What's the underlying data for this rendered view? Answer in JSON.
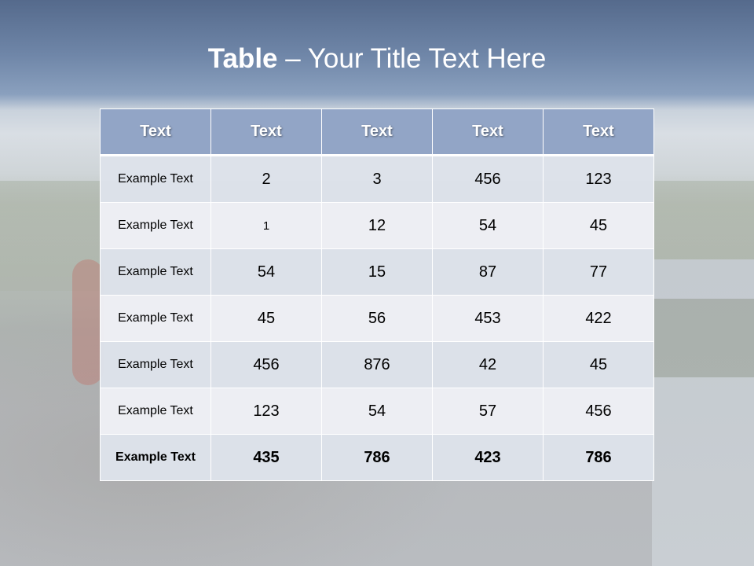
{
  "slide": {
    "title_bold": "Table",
    "title_rest": " – Your Title Text Here"
  },
  "table": {
    "headers": [
      "Text",
      "Text",
      "Text",
      "Text",
      "Text"
    ],
    "rows": [
      {
        "label": "Example Text",
        "values": [
          "2",
          "3",
          "456",
          "123"
        ]
      },
      {
        "label": "Example Text",
        "values": [
          "1",
          "12",
          "54",
          "45"
        ]
      },
      {
        "label": "Example Text",
        "values": [
          "54",
          "15",
          "87",
          "77"
        ]
      },
      {
        "label": "Example Text",
        "values": [
          "45",
          "56",
          "453",
          "422"
        ]
      },
      {
        "label": "Example Text",
        "values": [
          "456",
          "876",
          "42",
          "45"
        ]
      },
      {
        "label": "Example Text",
        "values": [
          "123",
          "54",
          "57",
          "456"
        ]
      },
      {
        "label": "Example Text",
        "values": [
          "435",
          "786",
          "423",
          "786"
        ]
      }
    ]
  },
  "colors": {
    "header_bg": "#92a5c6",
    "row_odd": "#dde2ea",
    "row_even": "#eef0f5"
  }
}
